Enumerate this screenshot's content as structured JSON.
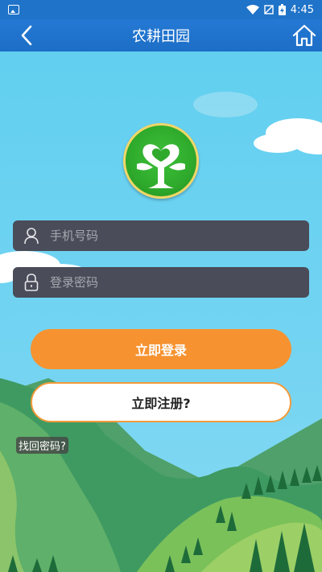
{
  "status_bar": {
    "time": "4:45"
  },
  "header": {
    "title": "农耕田园",
    "back_icon": "chevron-left-icon",
    "home_icon": "home-icon"
  },
  "login_form": {
    "phone_placeholder": "手机号码",
    "password_placeholder": "登录密码",
    "login_button": "立即登录",
    "register_button": "立即注册?",
    "forgot_link": "找回密码?"
  },
  "colors": {
    "header": "#1f73c8",
    "login_button": "#f69230",
    "field_bg": "#4a4c59",
    "sky": "#62cff0"
  }
}
